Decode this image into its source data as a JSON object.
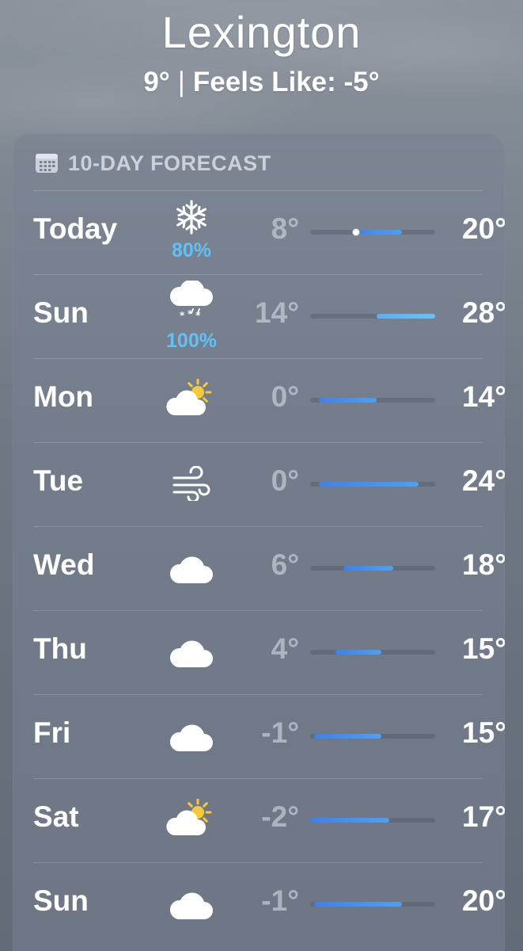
{
  "location": {
    "city": "Lexington",
    "current_temp": "9°",
    "separator": "|",
    "feels_like": "Feels Like: -5°"
  },
  "forecast": {
    "header_label": "10-DAY FORECAST",
    "range_min": -2,
    "range_max": 28,
    "days": [
      {
        "day": "Today",
        "icon": "snowflake-icon",
        "precip": "80%",
        "low": "8°",
        "high": "20°",
        "low_value": 8,
        "high_value": 20,
        "current_value": 9
      },
      {
        "day": "Sun",
        "icon": "snow-cloud-icon",
        "precip": "100%",
        "low": "14°",
        "high": "28°",
        "low_value": 14,
        "high_value": 28
      },
      {
        "day": "Mon",
        "icon": "partly-sunny-icon",
        "precip": "",
        "low": "0°",
        "high": "14°",
        "low_value": 0,
        "high_value": 14
      },
      {
        "day": "Tue",
        "icon": "wind-icon",
        "precip": "",
        "low": "0°",
        "high": "24°",
        "low_value": 0,
        "high_value": 24
      },
      {
        "day": "Wed",
        "icon": "cloud-icon",
        "precip": "",
        "low": "6°",
        "high": "18°",
        "low_value": 6,
        "high_value": 18
      },
      {
        "day": "Thu",
        "icon": "cloud-icon",
        "precip": "",
        "low": "4°",
        "high": "15°",
        "low_value": 4,
        "high_value": 15
      },
      {
        "day": "Fri",
        "icon": "cloud-icon",
        "precip": "",
        "low": "-1°",
        "high": "15°",
        "low_value": -1,
        "high_value": 15
      },
      {
        "day": "Sat",
        "icon": "partly-sunny-icon",
        "precip": "",
        "low": "-2°",
        "high": "17°",
        "low_value": -2,
        "high_value": 17
      },
      {
        "day": "Sun",
        "icon": "cloud-icon",
        "precip": "",
        "low": "-1°",
        "high": "20°",
        "low_value": -1,
        "high_value": 20
      }
    ]
  },
  "colors": {
    "precip_text": "#5fc1f5",
    "bar_blue": "#3f82e8",
    "sun_yellow": "#f5c93a"
  }
}
